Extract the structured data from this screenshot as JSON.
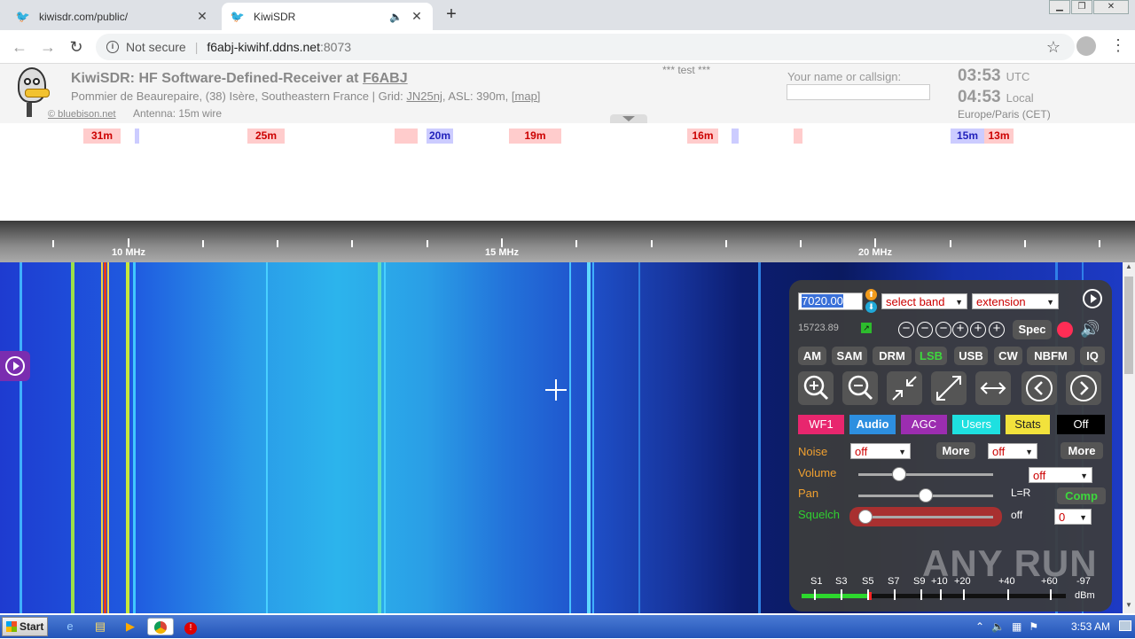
{
  "browser": {
    "tabs": [
      {
        "title": "kiwisdr.com/public/",
        "active": false
      },
      {
        "title": "KiwiSDR",
        "active": true
      }
    ],
    "omnibox": {
      "security": "Not secure",
      "host": "f6abj-kiwihf.ddns.net",
      "port": ":8073"
    }
  },
  "header": {
    "title_prefix": "KiwiSDR: HF Software-Defined-Receiver at ",
    "callsign": "F6ABJ",
    "location": "Pommier de Beaurepaire, (38) Isère, Southeastern France | Grid: ",
    "grid": "JN25nj",
    "asl": ", ASL: 390m, ",
    "map": "[map]",
    "antenna": "Antenna: 15m wire",
    "credit": "© bluebison.net",
    "test_msg": "*** test ***",
    "name_label": "Your name or callsign:",
    "name_value": "",
    "utc_time": "03:53",
    "utc_label": "UTC",
    "local_time": "04:53",
    "local_label": "Local",
    "timezone": "Europe/Paris (CET)"
  },
  "bands": [
    {
      "label": "31m",
      "type": "red"
    },
    {
      "label": "",
      "type": "blue"
    },
    {
      "label": "25m",
      "type": "red"
    },
    {
      "label": "",
      "type": "red"
    },
    {
      "label": "20m",
      "type": "blue"
    },
    {
      "label": "19m",
      "type": "red"
    },
    {
      "label": "16m",
      "type": "red"
    },
    {
      "label": "",
      "type": "blue"
    },
    {
      "label": "",
      "type": "red"
    },
    {
      "label": "15m",
      "type": "blue"
    },
    {
      "label": "13m",
      "type": "red"
    }
  ],
  "scale": {
    "labels": [
      "10 MHz",
      "15 MHz",
      "20 MHz"
    ]
  },
  "panel": {
    "frequency": "7020.00",
    "band_select": "select band",
    "extension_select": "extension",
    "cursor_freq": "15723.89",
    "spec_label": "Spec",
    "modes": [
      "AM",
      "SAM",
      "DRM",
      "LSB",
      "USB",
      "CW",
      "NBFM",
      "IQ"
    ],
    "selected_mode": "LSB",
    "tabs": [
      {
        "label": "WF1",
        "bg": "#e8266e",
        "fg": "#ffffff"
      },
      {
        "label": "Audio",
        "bg": "#2d8fe0",
        "fg": "#ffffff"
      },
      {
        "label": "AGC",
        "bg": "#9c2db0",
        "fg": "#ffffff"
      },
      {
        "label": "Users",
        "bg": "#1ee0e0",
        "fg": "#ffffff"
      },
      {
        "label": "Stats",
        "bg": "#f2e23c",
        "fg": "#222222"
      },
      {
        "label": "Off",
        "bg": "#000000",
        "fg": "#ffffff"
      }
    ],
    "noise_label": "Noise",
    "noise_value": "off",
    "more1": "More",
    "noise2_value": "off",
    "more2": "More",
    "volume_label": "Volume",
    "volume_select": "off",
    "volume_level": 0.28,
    "pan_label": "Pan",
    "pan_level": 0.5,
    "pan_readout": "L=R",
    "comp_label": "Comp",
    "squelch_label": "Squelch",
    "squelch_level": 0.0,
    "squelch_state": "off",
    "squelch_select": "0",
    "smeter": {
      "labels": [
        "S1",
        "S3",
        "S5",
        "S7",
        "S9",
        "+10",
        "+20",
        "+40",
        "+60",
        "-97"
      ],
      "unit": "dBm",
      "level": 0.25
    }
  },
  "watermark": "ANY RUN",
  "taskbar": {
    "start": "Start",
    "time": "3:53 AM"
  }
}
